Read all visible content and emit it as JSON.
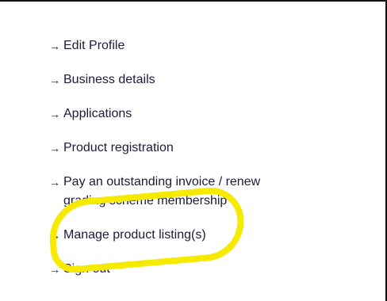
{
  "menu": {
    "items": [
      {
        "label": "Edit Profile",
        "icon": "arrow-right-icon"
      },
      {
        "label": "Business details",
        "icon": "arrow-right-icon"
      },
      {
        "label": "Applications",
        "icon": "arrow-right-icon"
      },
      {
        "label": "Product registration",
        "icon": "arrow-right-icon"
      },
      {
        "label_line_1": "Pay an outstanding invoice / renew",
        "label_line_2": "grading scheme membership",
        "icon": "arrow-right-icon"
      },
      {
        "label": "Manage product listing(s)",
        "icon": "arrow-right-icon",
        "highlighted": true
      },
      {
        "label": "Sign out",
        "icon": "arrow-right-icon"
      }
    ],
    "arrow_glyph": "→"
  },
  "colors": {
    "text": "#1b1b3a",
    "highlight": "#f5ea00",
    "frame": "#111111"
  }
}
